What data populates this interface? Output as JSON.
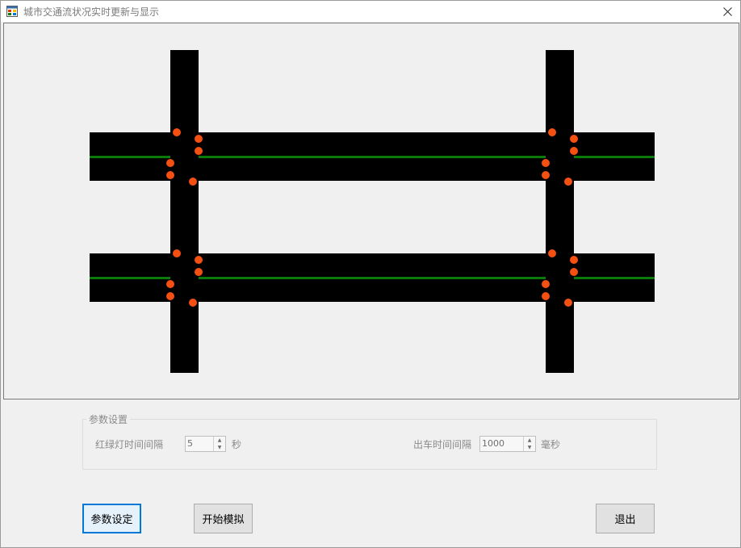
{
  "window": {
    "title": "城市交通流状况实时更新与显示"
  },
  "colors": {
    "road": "#000000",
    "lane_marking": "#0a7a0a",
    "traffic_light": "#f35012",
    "focus_border": "#0078d7"
  },
  "settings": {
    "group_title": "参数设置",
    "light_interval": {
      "label": "红绿灯时间间隔",
      "value": "5",
      "unit": "秒"
    },
    "departure_interval": {
      "label": "出车时间间隔",
      "value": "1000",
      "unit": "毫秒"
    }
  },
  "buttons": {
    "set_params": "参数设定",
    "start_sim": "开始模拟",
    "exit": "退出"
  }
}
